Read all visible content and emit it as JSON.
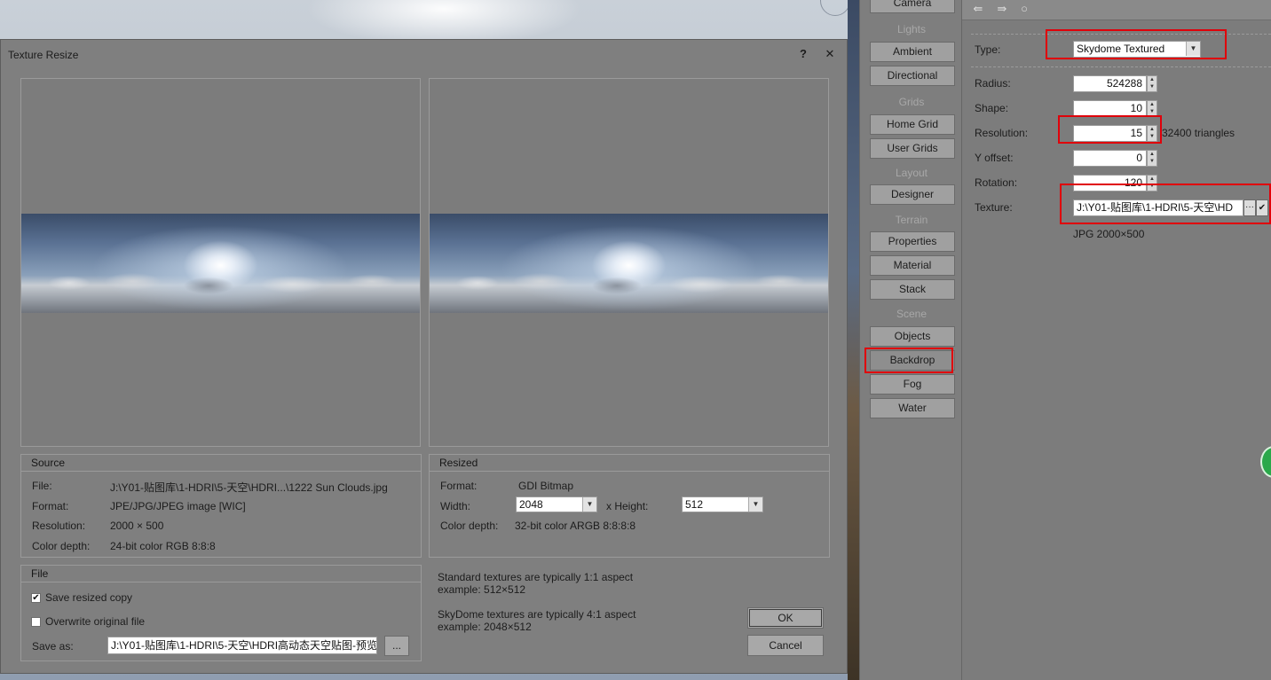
{
  "dialog": {
    "title": "Texture Resize",
    "help_glyph": "?",
    "close_glyph": "✕",
    "source": {
      "header": "Source",
      "file_label": "File:",
      "file_value": "J:\\Y01-贴图库\\1-HDRI\\5-天空\\HDRI...\\1222 Sun Clouds.jpg",
      "format_label": "Format:",
      "format_value": "JPE/JPG/JPEG image [WIC]",
      "resolution_label": "Resolution:",
      "resolution_value": "2000 × 500",
      "depth_label": "Color depth:",
      "depth_value": "24-bit color RGB 8:8:8"
    },
    "resized": {
      "header": "Resized",
      "format_label": "Format:",
      "format_value": "GDI Bitmap",
      "width_label": "Width:",
      "width_value": "2048",
      "height_label": "x Height:",
      "height_value": "512",
      "depth_label": "Color depth:",
      "depth_value": "32-bit color ARGB 8:8:8:8"
    },
    "file": {
      "header": "File",
      "save_resized_label": "Save resized copy",
      "save_resized_checked": "✔",
      "overwrite_label": "Overwrite original file",
      "overwrite_checked": "",
      "save_as_label": "Save as:",
      "save_as_value": "J:\\Y01-贴图库\\1-HDRI\\5-天空\\HDRI高动态天空贴图-预览",
      "browse_label": "..."
    },
    "note1_line1": "Standard textures are typically 1:1 aspect",
    "note1_line2": "example: 512×512",
    "note2_line1": "SkyDome textures are typically 4:1 aspect",
    "note2_line2": "example: 2048×512",
    "ok_label": "OK",
    "cancel_label": "Cancel"
  },
  "midcol": {
    "camera": "Camera",
    "lights": "Lights",
    "ambient": "Ambient",
    "directional": "Directional",
    "grids": "Grids",
    "home_grid": "Home Grid",
    "user_grids": "User Grids",
    "layout": "Layout",
    "designer": "Designer",
    "terrain": "Terrain",
    "properties": "Properties",
    "material": "Material",
    "stack": "Stack",
    "scene": "Scene",
    "objects": "Objects",
    "backdrop": "Backdrop",
    "fog": "Fog",
    "water": "Water"
  },
  "props": {
    "toolbar_icon1": "⇚",
    "toolbar_icon2": "⇛",
    "toolbar_icon3": "○",
    "type_label": "Type:",
    "type_value": "Skydome Textured",
    "radius_label": "Radius:",
    "radius_value": "524288",
    "shape_label": "Shape:",
    "shape_value": "10",
    "resolution_label": "Resolution:",
    "resolution_value": "15",
    "triangles": "32400 triangles",
    "yoffset_label": "Y offset:",
    "yoffset_value": "0",
    "rotation_label": "Rotation:",
    "rotation_value": "120",
    "texture_label": "Texture:",
    "texture_value": "J:\\Y01-贴图库\\1-HDRI\\5-天空\\HD",
    "texture_browse": "···",
    "texture_check": "✔",
    "texture_info": "JPG 2000×500"
  },
  "colors": {
    "highlight": "#e0000a",
    "badge": "#2aa84a"
  }
}
